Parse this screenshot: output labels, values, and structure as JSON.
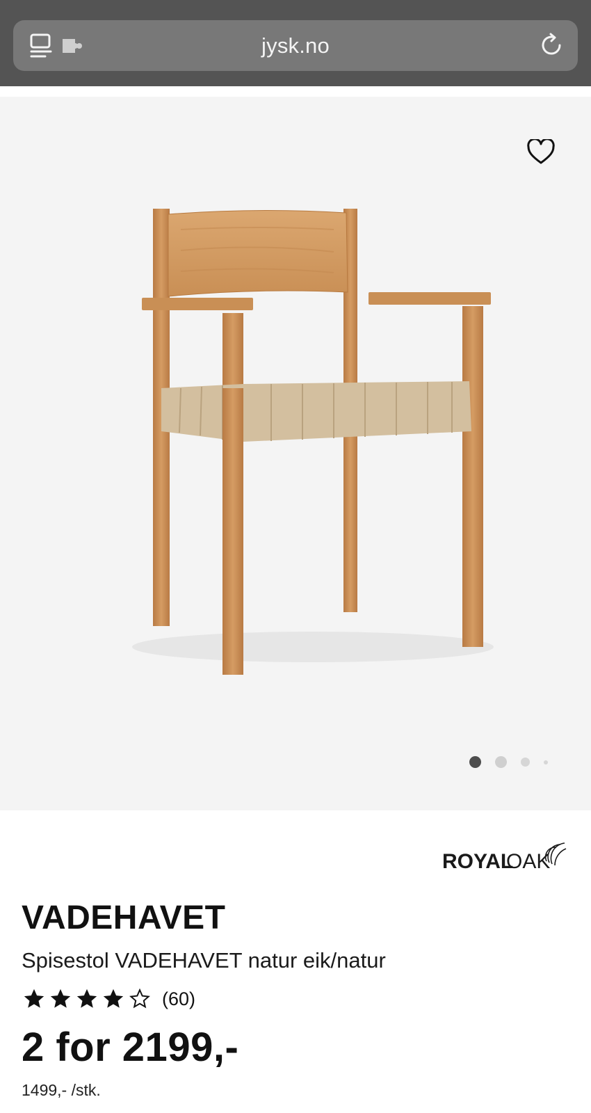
{
  "browser": {
    "url": "jysk.no",
    "icons": [
      "reader-icon",
      "extension-icon",
      "reload-icon"
    ]
  },
  "gallery": {
    "favorite_icon": "heart-icon",
    "image": "oak-dining-chair-with-webbing-seat",
    "page_dots": 4,
    "active_dot": 1
  },
  "product": {
    "brand": "ROYAL OAK",
    "brand_name_bold": "ROYAL",
    "brand_name_light": "OAK",
    "title": "VADEHAVET",
    "subtitle": "Spisestol VADEHAVET natur eik/natur",
    "rating": {
      "stars": 4.5,
      "max": 5,
      "count_label": "(60)"
    },
    "price_label": "2 for 2199,-",
    "unit_price_label": "1499,- /stk."
  },
  "colors": {
    "chrome_bg": "#545454",
    "urlbar_bg": "#787878",
    "gallery_bg": "#f4f4f4",
    "wood": "#c98f55",
    "webbing": "#d3bf9f"
  }
}
